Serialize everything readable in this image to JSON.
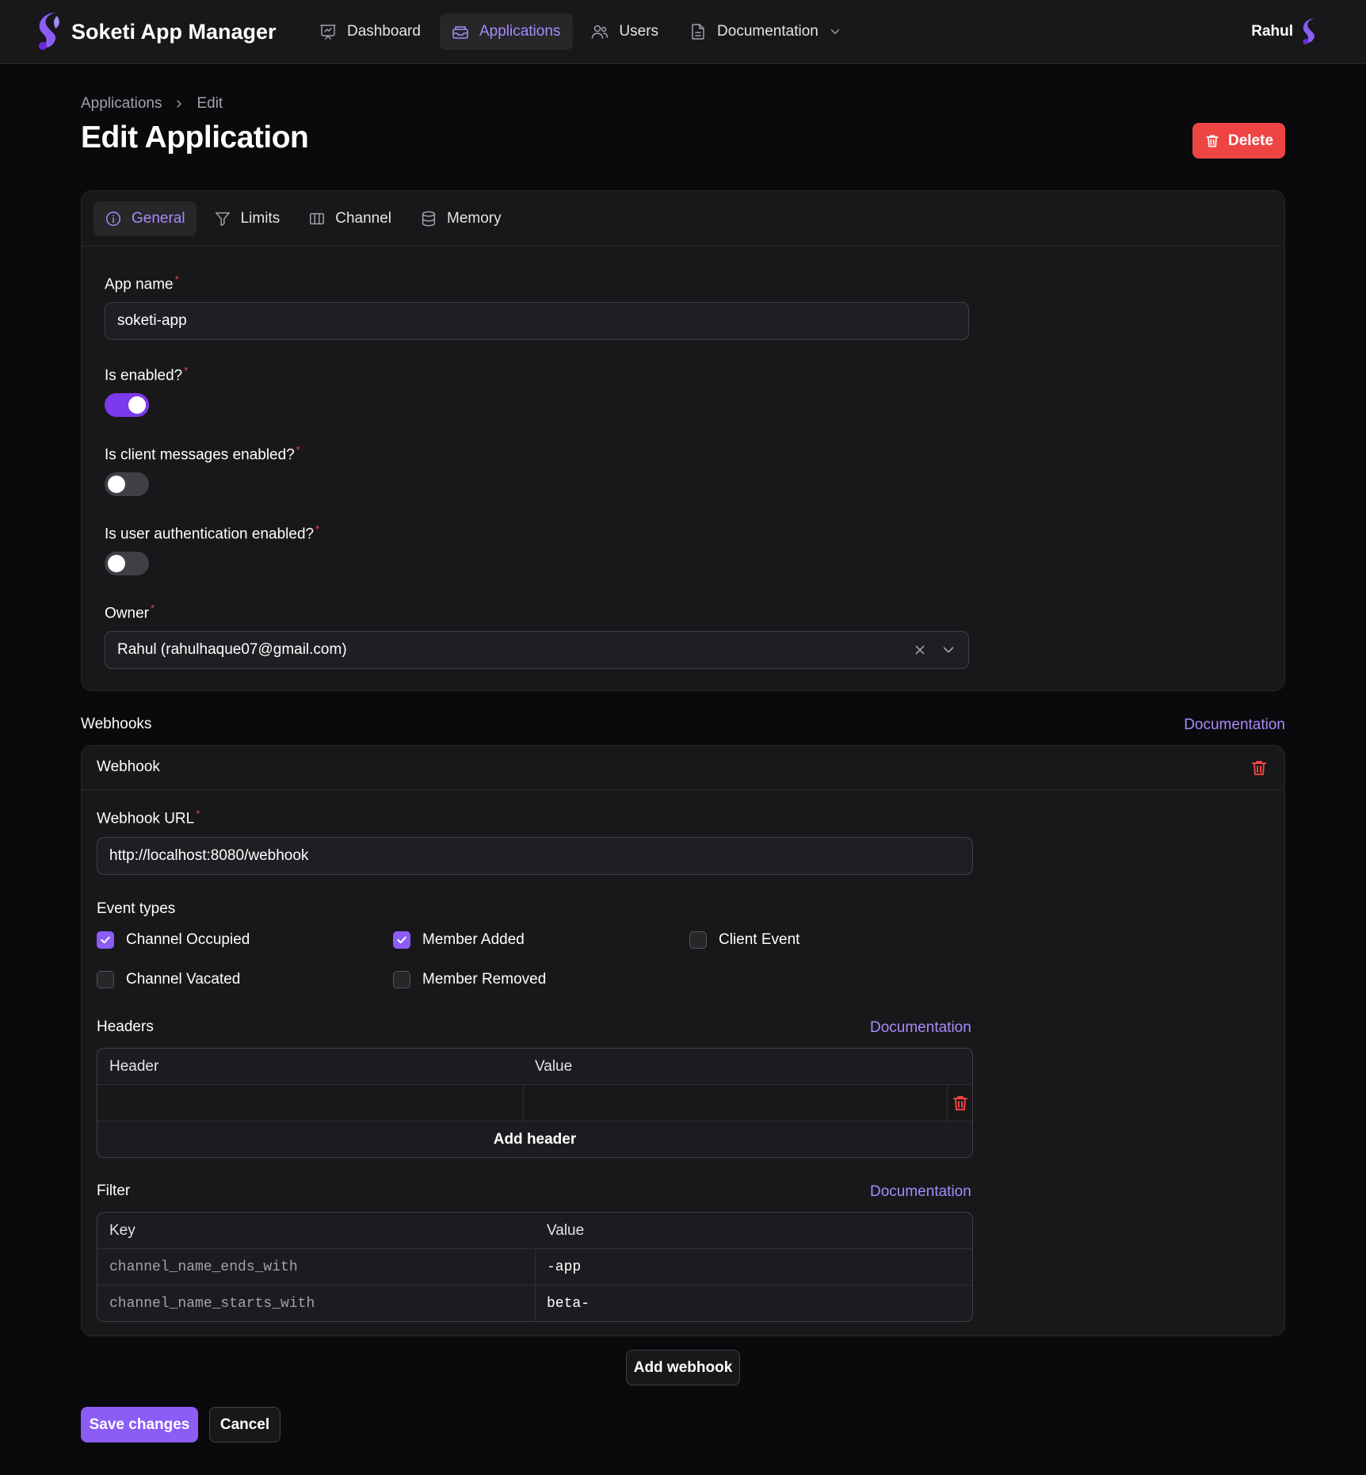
{
  "app": {
    "title": "Soketi App Manager"
  },
  "nav": {
    "items": [
      {
        "label": "Dashboard",
        "icon": "presentation-chart-icon"
      },
      {
        "label": "Applications",
        "icon": "inbox-stack-icon",
        "active": true
      },
      {
        "label": "Users",
        "icon": "users-icon"
      },
      {
        "label": "Documentation",
        "icon": "document-icon"
      }
    ],
    "user_name": "Rahul"
  },
  "breadcrumb": {
    "items": [
      "Applications",
      "Edit"
    ]
  },
  "page": {
    "title": "Edit Application",
    "delete_label": "Delete"
  },
  "tabs": [
    {
      "label": "General",
      "icon": "info-circle-icon",
      "active": true
    },
    {
      "label": "Limits",
      "icon": "funnel-icon"
    },
    {
      "label": "Channel",
      "icon": "view-columns-icon"
    },
    {
      "label": "Memory",
      "icon": "database-icon"
    }
  ],
  "form": {
    "app_name": {
      "label": "App name",
      "value": "soketi-app"
    },
    "is_enabled": {
      "label": "Is enabled?",
      "value": true
    },
    "client_messages": {
      "label": "Is client messages enabled?",
      "value": false
    },
    "user_auth": {
      "label": "Is user authentication enabled?",
      "value": false
    },
    "owner": {
      "label": "Owner",
      "value": "Rahul (rahulhaque07@gmail.com)"
    }
  },
  "webhooks": {
    "section_title": "Webhooks",
    "doc_label": "Documentation",
    "webhook": {
      "title": "Webhook",
      "url_label": "Webhook URL",
      "url_value": "http://localhost:8080/webhook",
      "event_types_label": "Event types",
      "events": [
        {
          "label": "Channel Occupied",
          "checked": true
        },
        {
          "label": "Member Added",
          "checked": true
        },
        {
          "label": "Client Event",
          "checked": false
        },
        {
          "label": "Channel Vacated",
          "checked": false
        },
        {
          "label": "Member Removed",
          "checked": false
        }
      ],
      "headers": {
        "label": "Headers",
        "doc_label": "Documentation",
        "col_header": "Header",
        "col_value": "Value",
        "add_label": "Add header"
      },
      "filter": {
        "label": "Filter",
        "doc_label": "Documentation",
        "col_key": "Key",
        "col_value": "Value",
        "rows": [
          {
            "key": "channel_name_ends_with",
            "value": "-app"
          },
          {
            "key": "channel_name_starts_with",
            "value": "beta-"
          }
        ]
      }
    },
    "add_webhook_label": "Add webhook"
  },
  "footer": {
    "save_label": "Save changes",
    "cancel_label": "Cancel"
  },
  "colors": {
    "accent": "#8b5cf6",
    "danger": "#ef4444",
    "background": "#0a0a0c",
    "surface": "#18181b"
  }
}
